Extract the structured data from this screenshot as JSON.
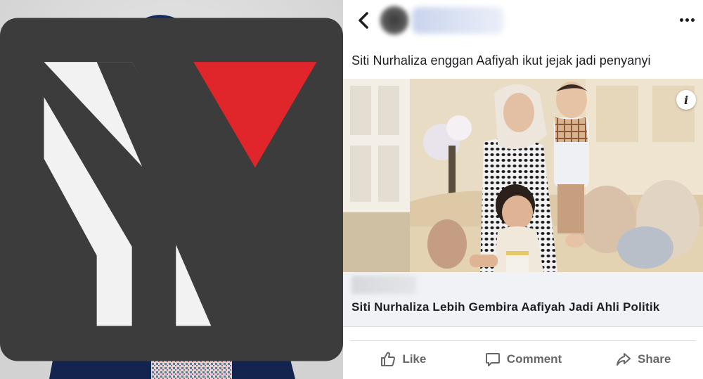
{
  "post": {
    "text": "Siti Nurhaliza enggan Aafiyah ikut jejak jadi penyanyi",
    "link_title": "Siti Nurhaliza Lebih Gembira Aafiyah Jadi Ahli Politik",
    "info_glyph": "i"
  },
  "actions": {
    "like": "Like",
    "comment": "Comment",
    "share": "Share"
  },
  "colors": {
    "fb_text": "#1c1e21",
    "fb_secondary": "#65676b",
    "caption_bg": "#f0f2f5",
    "logo_red": "#e0262b",
    "logo_dark": "#3c3c3c"
  },
  "icons": {
    "back": "chevron-left-icon",
    "more": "more-dots-icon",
    "info": "info-icon",
    "like": "thumbs-up-icon",
    "comment": "speech-bubble-icon",
    "share": "share-arrow-icon"
  }
}
